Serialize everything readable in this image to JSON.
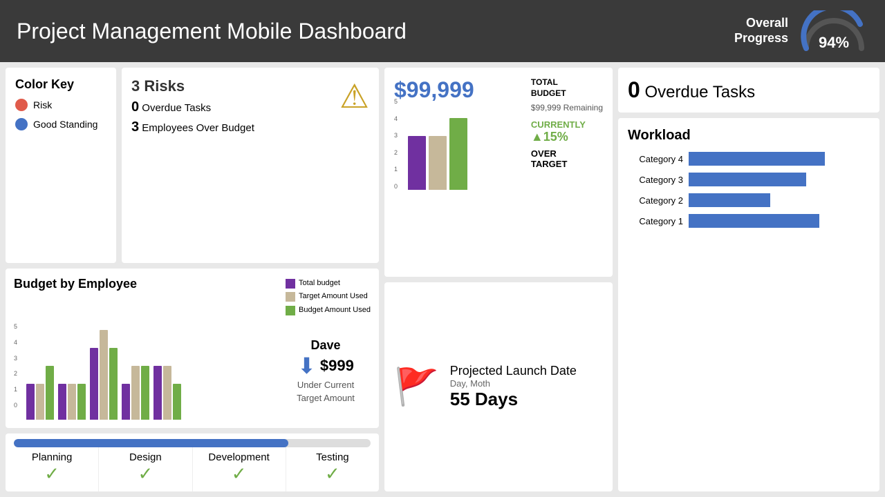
{
  "header": {
    "title": "Project Management Mobile Dashboard",
    "overall_label": "Overall\nProgress",
    "progress_pct": "94%"
  },
  "color_key": {
    "title": "Color Key",
    "items": [
      {
        "label": "Risk",
        "color": "risk"
      },
      {
        "label": "Good Standing",
        "color": "good"
      }
    ]
  },
  "risks": {
    "count": "3",
    "label": "Risks",
    "overdue_count": "0",
    "overdue_label": "Overdue Tasks",
    "employees_count": "3",
    "employees_label": "Employees Over Budget"
  },
  "budget_summary": {
    "amount": "$99,999",
    "total_label": "TOTAL\nBUDGET",
    "remaining": "$99,999 Remaining",
    "currently_label": "CURRENTLY",
    "pct": "15%",
    "over_target_label": "OVER\nTARGET"
  },
  "budget_employee": {
    "title": "Budget by Employee",
    "legend": {
      "total": "Total budget",
      "target": "Target Amount Used",
      "budget": "Budget Amount Used"
    },
    "dave": {
      "name": "Dave",
      "amount": "$999",
      "description": "Under Current\nTarget Amount"
    },
    "bars": [
      {
        "total": 2,
        "target": 2,
        "budget": 3
      },
      {
        "total": 2,
        "target": 2,
        "budget": 2
      },
      {
        "total": 4,
        "target": 5,
        "budget": 4
      },
      {
        "total": 2,
        "target": 3,
        "budget": 3
      },
      {
        "total": 3,
        "target": 3,
        "budget": 2
      }
    ]
  },
  "overdue": {
    "count": "0",
    "label": "Overdue Tasks"
  },
  "launch": {
    "title": "Projected\nLaunch Date",
    "sub": "Day, Moth",
    "days": "55 Days"
  },
  "phases": {
    "progress_pct": 77,
    "items": [
      {
        "name": "Planning",
        "done": true
      },
      {
        "name": "Design",
        "done": true
      },
      {
        "name": "Development",
        "done": true
      },
      {
        "name": "Testing",
        "done": true
      }
    ]
  },
  "workload": {
    "title": "Workload",
    "categories": [
      {
        "label": "Category 4",
        "value": 75
      },
      {
        "label": "Category 3",
        "value": 65
      },
      {
        "label": "Category 2",
        "value": 45
      },
      {
        "label": "Category 1",
        "value": 72
      }
    ]
  }
}
